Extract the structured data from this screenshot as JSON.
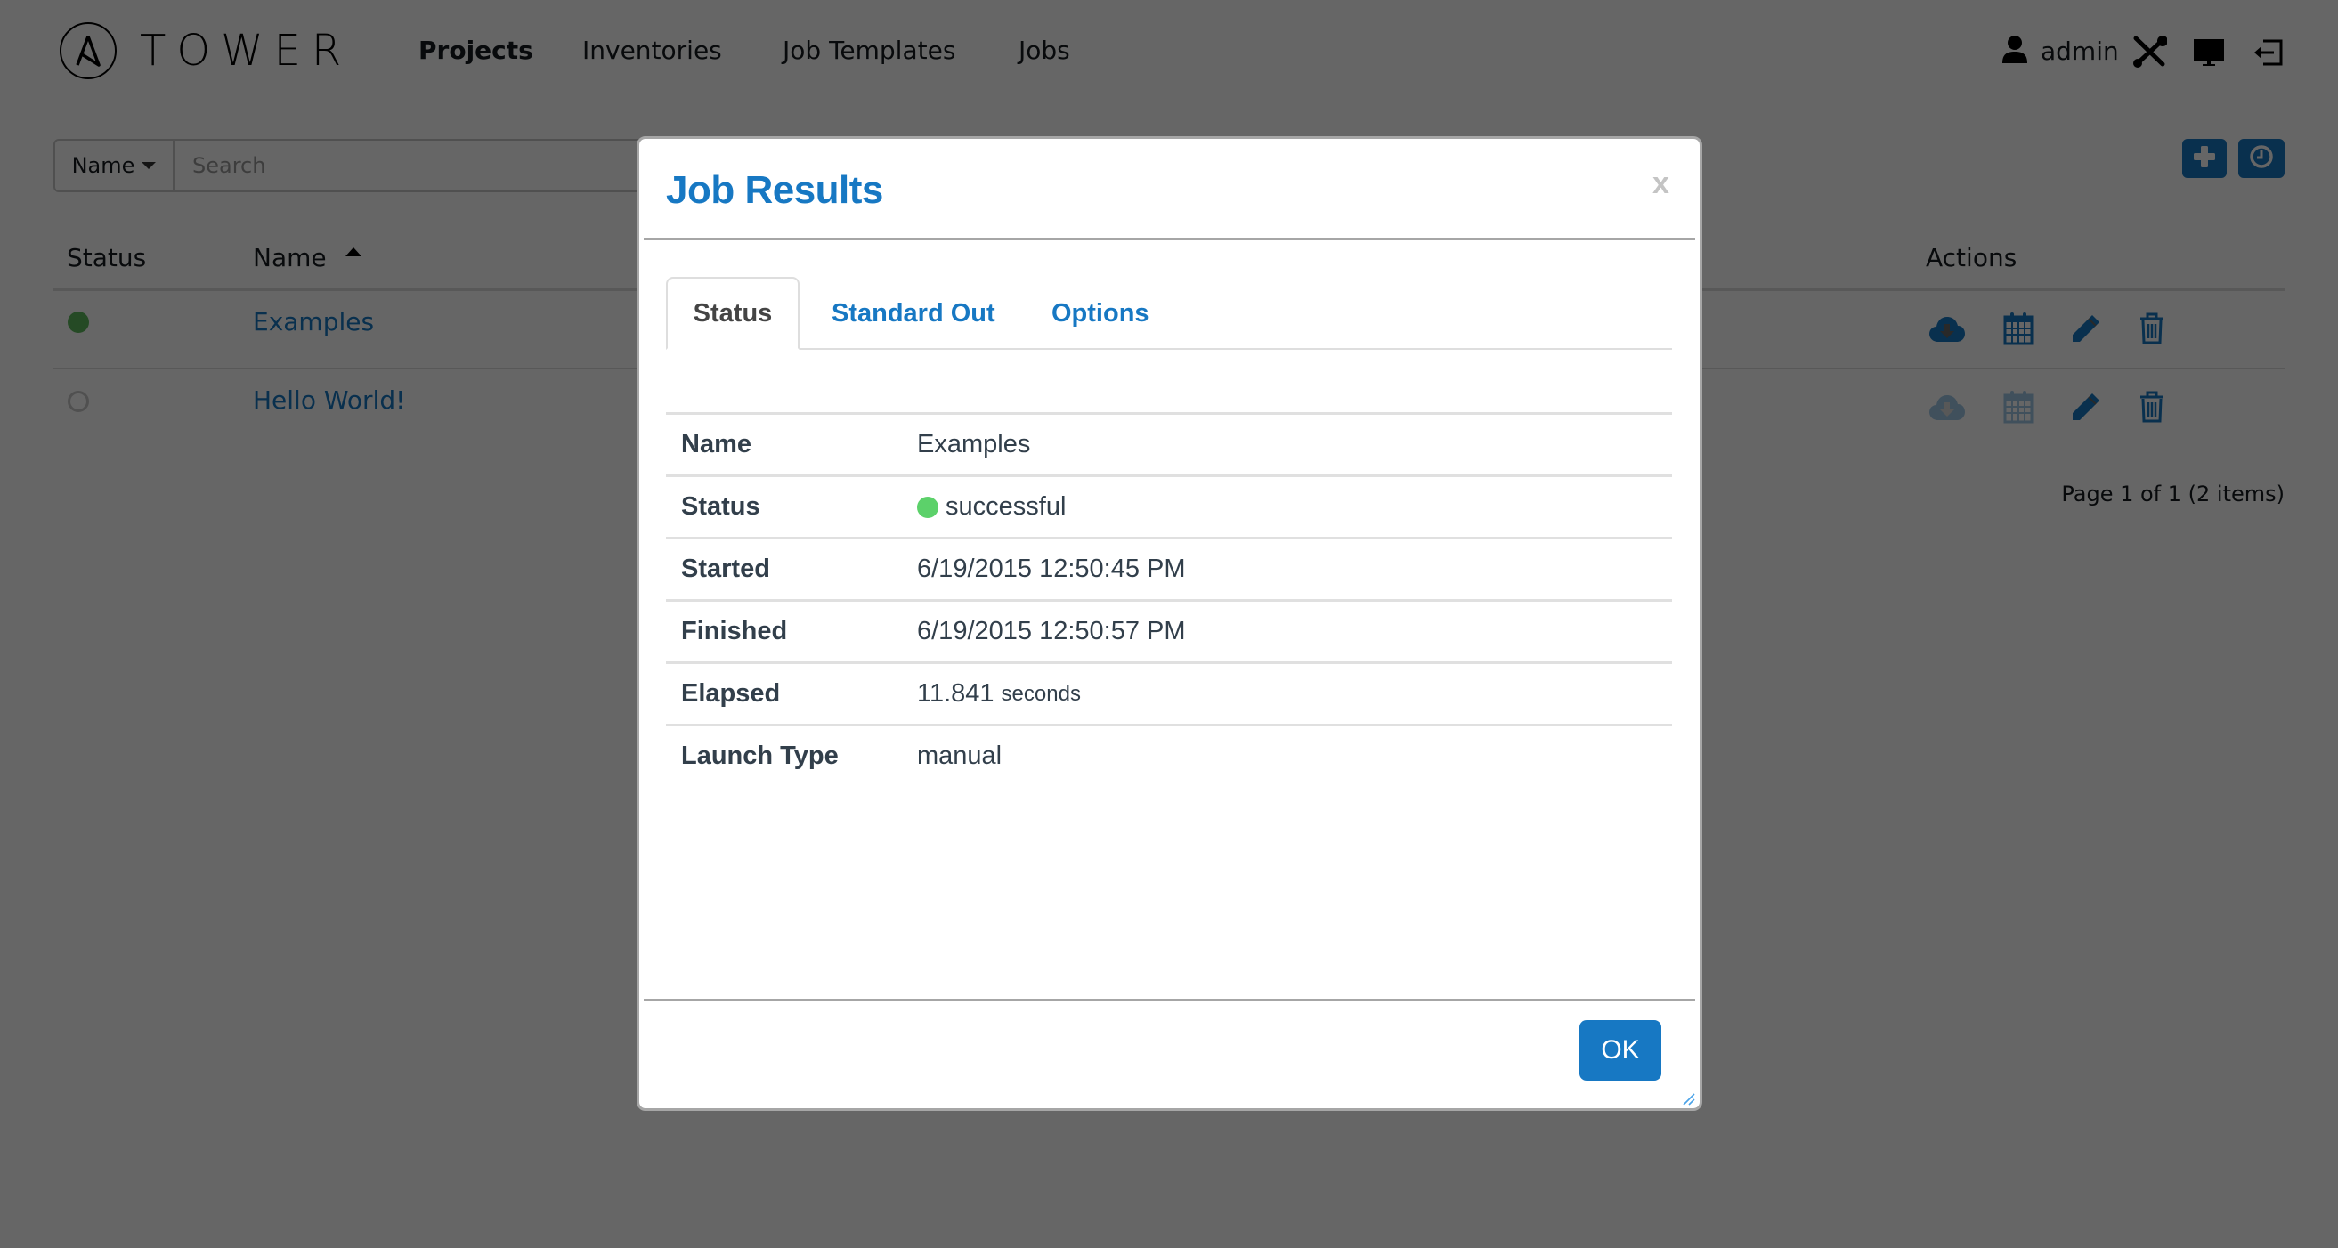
{
  "header": {
    "logo_text": "TOWER",
    "nav": [
      {
        "label": "Projects",
        "active": true
      },
      {
        "label": "Inventories",
        "active": false
      },
      {
        "label": "Job Templates",
        "active": false
      },
      {
        "label": "Jobs",
        "active": false
      }
    ],
    "user": {
      "name": "admin",
      "icon": "user-icon"
    },
    "utility_icons": [
      "tools-icon",
      "monitor-icon",
      "logout-icon"
    ]
  },
  "search": {
    "field_label": "Name",
    "placeholder": "Search",
    "value": ""
  },
  "toolbar": {
    "buttons": [
      {
        "icon": "plus-icon",
        "label": "Add"
      },
      {
        "icon": "clock-icon",
        "label": "Activity stream"
      }
    ]
  },
  "table": {
    "columns": {
      "status": "Status",
      "name": "Name",
      "actions": "Actions"
    },
    "sort": {
      "column": "Name",
      "direction": "ascending"
    },
    "rows": [
      {
        "status": "successful",
        "name": "Examples",
        "actions": [
          {
            "icon": "cloud-download-icon",
            "enabled": true
          },
          {
            "icon": "calendar-icon",
            "enabled": true
          },
          {
            "icon": "pencil-icon",
            "enabled": true
          },
          {
            "icon": "trash-icon",
            "enabled": true
          }
        ]
      },
      {
        "status": "never updated",
        "name": "Hello World!",
        "actions": [
          {
            "icon": "cloud-download-icon",
            "enabled": false
          },
          {
            "icon": "calendar-icon",
            "enabled": false
          },
          {
            "icon": "pencil-icon",
            "enabled": true
          },
          {
            "icon": "trash-icon",
            "enabled": true
          }
        ]
      }
    ],
    "pagination": "Page 1 of 1 (2 items)"
  },
  "modal": {
    "title": "Job Results",
    "close_label": "x",
    "tabs": [
      {
        "label": "Status",
        "active": true
      },
      {
        "label": "Standard Out",
        "active": false
      },
      {
        "label": "Options",
        "active": false
      }
    ],
    "details": {
      "name": {
        "label": "Name",
        "value": "Examples"
      },
      "status": {
        "label": "Status",
        "value": "successful"
      },
      "started": {
        "label": "Started",
        "value": "6/19/2015 12:50:45 PM"
      },
      "finished": {
        "label": "Finished",
        "value": "6/19/2015 12:50:57 PM"
      },
      "elapsed": {
        "label": "Elapsed",
        "value": "11.841",
        "unit": "seconds"
      },
      "launch_type": {
        "label": "Launch Type",
        "value": "manual"
      }
    },
    "ok_label": "OK"
  },
  "colors": {
    "accent": "#1778c3",
    "success": "#5cd16a",
    "text": "#323f4b",
    "overlay": "rgba(0,0,0,0.6)"
  }
}
